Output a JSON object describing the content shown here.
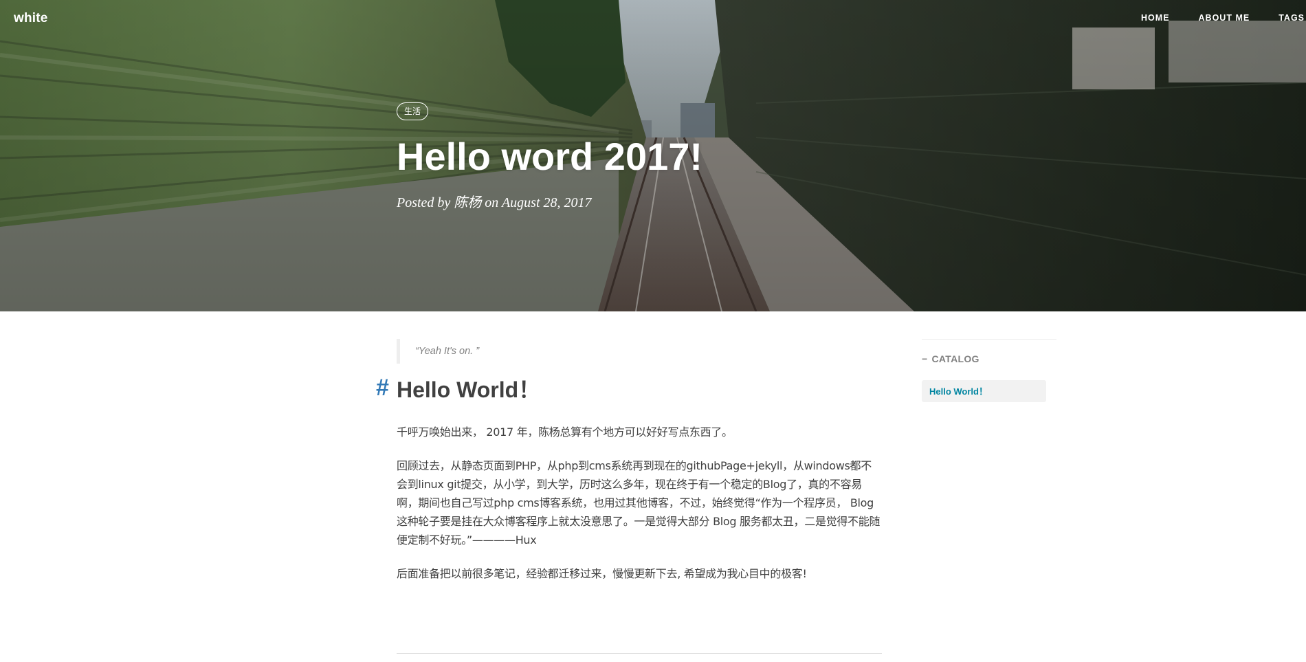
{
  "navbar": {
    "brand": "white",
    "links": [
      "HOME",
      "ABOUT ME",
      "TAGS"
    ]
  },
  "post": {
    "tag": "生活",
    "title": "Hello word 2017!",
    "meta": "Posted by 陈杨 on August 28, 2017"
  },
  "content": {
    "quote": "“Yeah It's on. ”",
    "anchor": "#",
    "heading": "Hello World！",
    "paragraphs": [
      "千呼万唤始出来， 2017 年，陈杨总算有个地方可以好好写点东西了。",
      "回顾过去，从静态页面到PHP，从php到cms系统再到现在的githubPage+jekyll，从windows都不会到linux git提交，从小学，到大学，历时这么多年，现在终于有一个稳定的Blog了，真的不容易啊，期间也自己写过php cms博客系统，也用过其他博客，不过，始终觉得“作为一个程序员， Blog 这种轮子要是挂在大众博客程序上就太没意思了。一是觉得大部分 Blog 服务都太丑，二是觉得不能随便定制不好玩。”————Hux",
      "后面准备把以前很多笔记，经验都迁移过来，慢慢更新下去, 希望成为我心目中的极客!"
    ]
  },
  "sidebar": {
    "catalog_title": "CATALOG",
    "collapse_symbol": "−",
    "items": [
      "Hello World！"
    ]
  },
  "colors": {
    "link": "#0085a1",
    "anchor": "#337ab7",
    "text": "#404040"
  },
  "icons": {
    "collapse": "minus-icon",
    "anchor": "hash-anchor-icon"
  }
}
